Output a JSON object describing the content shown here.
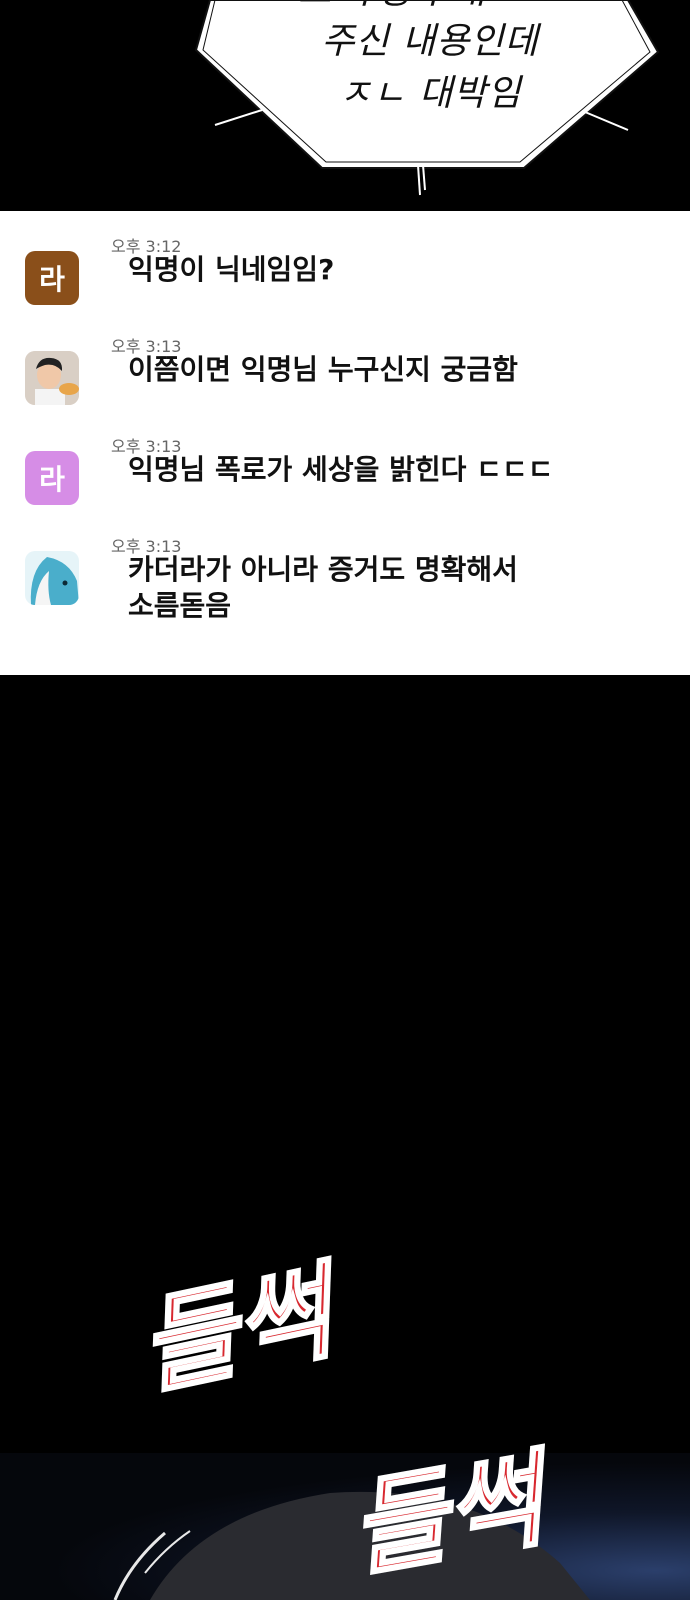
{
  "speech_bubble": {
    "lines": [
      "ㅗ느 ㅓ뭉ㅓ ㅐㅗㅜㅜ",
      "주신 내용인데",
      "ㅈㄴ 대박임"
    ]
  },
  "chat": {
    "messages": [
      {
        "time": "오후 3:12",
        "text": "익명이 닉네임임?",
        "avatar_letter": "라",
        "avatar_color": "#8a4f1a"
      },
      {
        "time": "오후 3:13",
        "text": "이쯤이면 익명님 누구신지 궁금함",
        "avatar_letter": "",
        "avatar_color": "#d8c7b6"
      },
      {
        "time": "오후 3:13",
        "text": "익명님 폭로가 세상을 밝힌다 ㄷㄷㄷ",
        "avatar_letter": "라",
        "avatar_color": "#d68de6"
      },
      {
        "time": "오후 3:13",
        "text_lines": [
          "카더라가 아니라 증거도 명확해서",
          "소름돋음"
        ],
        "avatar_letter": "",
        "avatar_color": "#5bb9d6"
      }
    ]
  },
  "sfx": [
    "들썩",
    "들썩"
  ],
  "colors": {
    "sfx": "#d8282f",
    "chat_bg": "#ffffff",
    "page_bg": "#000000"
  }
}
